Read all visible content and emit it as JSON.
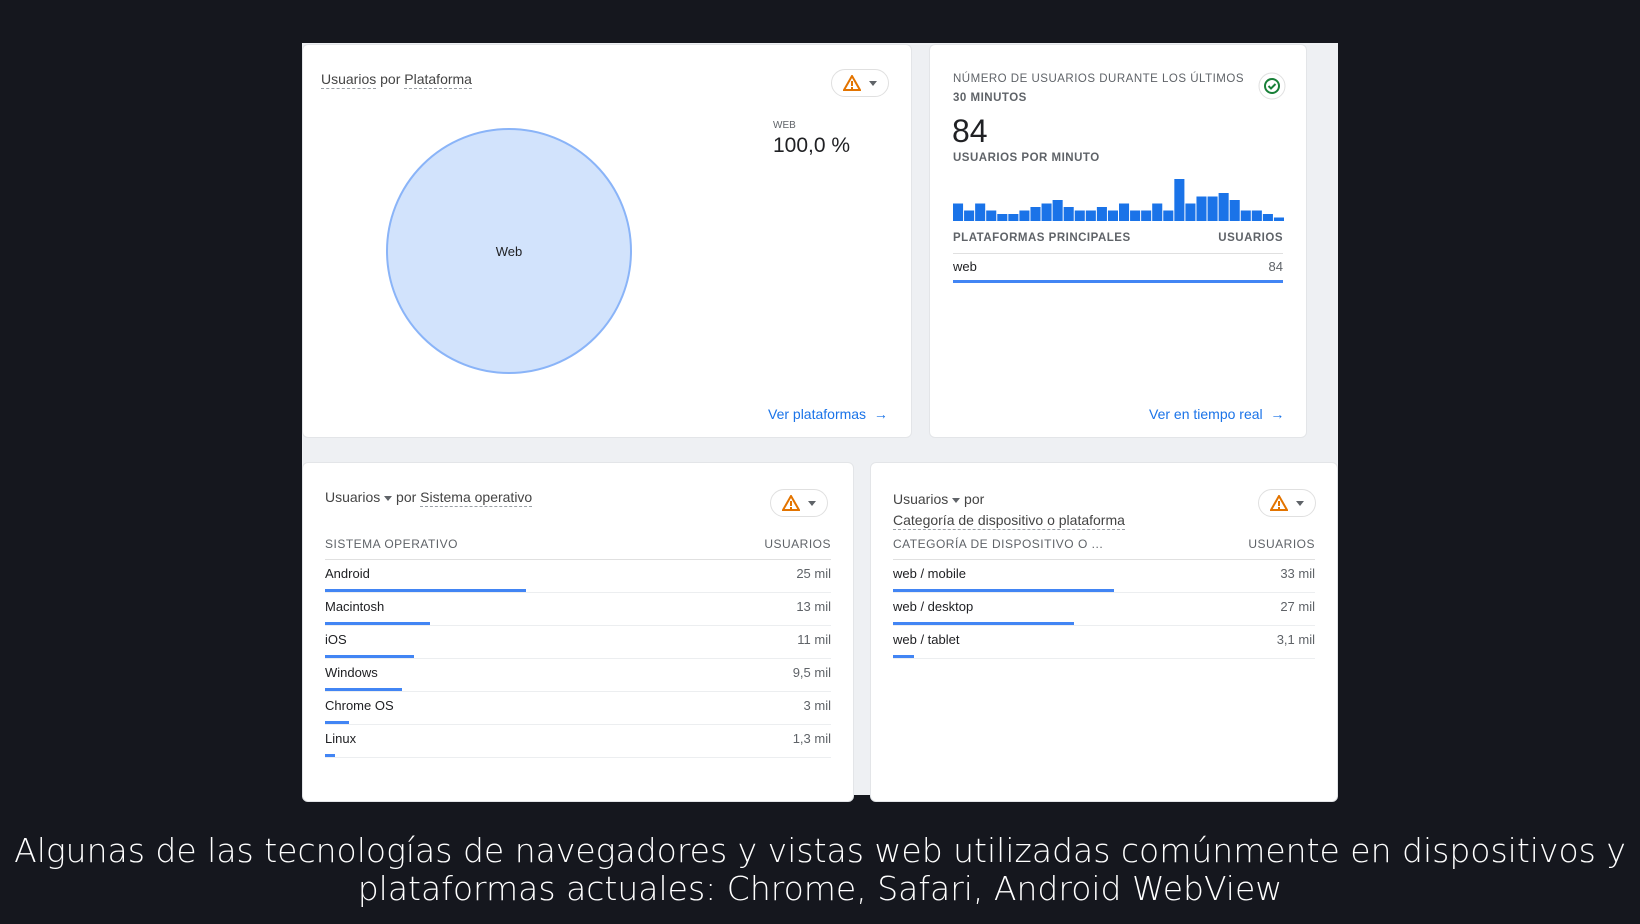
{
  "platform_card": {
    "title_metric": "Usuarios",
    "title_by": "por",
    "title_dimension": "Plataforma",
    "legend_label": "WEB",
    "legend_value": "100,0 %",
    "pie_label": "Web",
    "pie_share": 100,
    "link": "Ver plataformas"
  },
  "realtime_card": {
    "title_line1": "NÚMERO DE USUARIOS DURANTE LOS ÚLTIMOS",
    "title_line2": "30 MINUTOS",
    "count": "84",
    "per_minute_label": "USUARIOS POR MINUTO",
    "per_minute": [
      5,
      3,
      5,
      3,
      2,
      2,
      3,
      4,
      5,
      6,
      4,
      3,
      3,
      4,
      3,
      5,
      3,
      3,
      5,
      3,
      12,
      5,
      7,
      7,
      8,
      6,
      3,
      3,
      2,
      1
    ],
    "col_platform": "PLATAFORMAS PRINCIPALES",
    "col_users": "USUARIOS",
    "rows": [
      {
        "label": "web",
        "value": "84",
        "share": 1
      }
    ],
    "link": "Ver en tiempo real"
  },
  "os_card": {
    "title_metric": "Usuarios",
    "title_by": "por",
    "title_dimension": "Sistema operativo",
    "col_dim": "SISTEMA OPERATIVO",
    "col_users": "USUARIOS",
    "rows": [
      {
        "label": "Android",
        "value": "25 mil",
        "num": 25
      },
      {
        "label": "Macintosh",
        "value": "13 mil",
        "num": 13
      },
      {
        "label": "iOS",
        "value": "11 mil",
        "num": 11
      },
      {
        "label": "Windows",
        "value": "9,5 mil",
        "num": 9.5
      },
      {
        "label": "Chrome OS",
        "value": "3 mil",
        "num": 3
      },
      {
        "label": "Linux",
        "value": "1,3 mil",
        "num": 1.3
      }
    ]
  },
  "device_card": {
    "title_metric": "Usuarios",
    "title_by": "por",
    "title_dimension": "Categoría de dispositivo o plataforma",
    "col_dim": "CATEGORÍA DE DISPOSITIVO O ...",
    "col_users": "USUARIOS",
    "rows": [
      {
        "label": "web / mobile",
        "value": "33 mil",
        "num": 33
      },
      {
        "label": "web / desktop",
        "value": "27 mil",
        "num": 27
      },
      {
        "label": "web / tablet",
        "value": "3,1 mil",
        "num": 3.1
      }
    ]
  },
  "colors": {
    "accent": "#1a73e8",
    "bar": "#4285f4",
    "warning": "#e37400",
    "ok": "#188038"
  },
  "caption": {
    "line1": "Algunas de las tecnologías de navegadores y vistas web utilizadas comúnmente en dispositivos y",
    "line2": "plataformas actuales: Chrome, Safari, Android WebView"
  }
}
